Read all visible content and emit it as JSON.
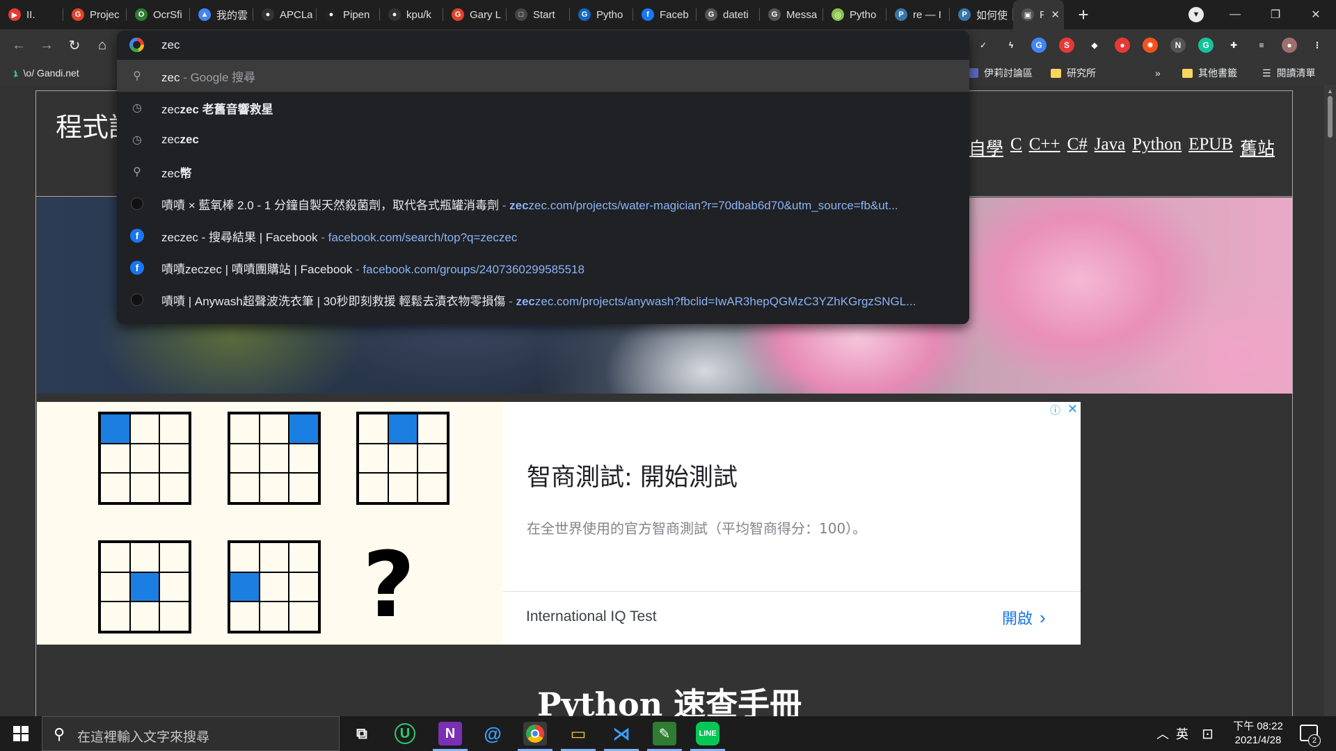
{
  "tabs": [
    {
      "title": "II.",
      "color": "#e53935",
      "glyph": "▶"
    },
    {
      "title": "Projec",
      "color": "#e24329",
      "glyph": "G"
    },
    {
      "title": "OcrSfi",
      "color": "#2e7d32",
      "glyph": "O"
    },
    {
      "title": "我的雲",
      "color": "#4285f4",
      "glyph": "▲"
    },
    {
      "title": "APCLa",
      "color": "#333333",
      "glyph": "●"
    },
    {
      "title": "Pipen",
      "color": "#222222",
      "glyph": "●"
    },
    {
      "title": "kpu/k",
      "color": "#333333",
      "glyph": "●"
    },
    {
      "title": "Gary L",
      "color": "#e24329",
      "glyph": "G"
    },
    {
      "title": "Start",
      "color": "#444444",
      "glyph": "□"
    },
    {
      "title": "Pytho",
      "color": "#1565c0",
      "glyph": "G"
    },
    {
      "title": "Faceb",
      "color": "#1877f2",
      "glyph": "f"
    },
    {
      "title": "dateti",
      "color": "#555555",
      "glyph": "G"
    },
    {
      "title": "Messa",
      "color": "#555555",
      "glyph": "G"
    },
    {
      "title": "Pytho",
      "color": "#8bc34a",
      "glyph": "◎"
    },
    {
      "title": "re — I",
      "color": "#3776ab",
      "glyph": "P"
    },
    {
      "title": "如何使",
      "color": "#3776ab",
      "glyph": "P"
    }
  ],
  "active_tab": {
    "title": "Py",
    "close": "✕"
  },
  "new_tab": "+",
  "window_controls": {
    "minimize": "—",
    "maximize": "❐",
    "close": "✕"
  },
  "toolbar": {
    "back": "←",
    "forward": "→",
    "reload": "↻",
    "home": "⌂"
  },
  "extensions": [
    {
      "name": "check-icon",
      "glyph": "✓",
      "color": "#353535"
    },
    {
      "name": "bolt-icon",
      "glyph": "ϟ",
      "color": "#353535"
    },
    {
      "name": "translate-icon",
      "glyph": "G",
      "color": "#4285f4"
    },
    {
      "name": "s-extension-icon",
      "glyph": "S",
      "color": "#e53935"
    },
    {
      "name": "diamond-icon",
      "glyph": "◆",
      "color": "#353535"
    },
    {
      "name": "record-icon",
      "glyph": "●",
      "color": "#e53935"
    },
    {
      "name": "fire-icon",
      "glyph": "✹",
      "color": "#f4511e"
    },
    {
      "name": "notion-icon",
      "glyph": "N",
      "color": "#555555"
    },
    {
      "name": "grammarly-icon",
      "glyph": "G",
      "color": "#15c39a"
    },
    {
      "name": "puzzle-icon",
      "glyph": "✚",
      "color": "#353535"
    },
    {
      "name": "reading-list-icon",
      "glyph": "≡",
      "color": "#353535"
    },
    {
      "name": "profile-avatar",
      "glyph": "●",
      "color": "#9e6f6f"
    },
    {
      "name": "menu-icon",
      "glyph": "⋮",
      "color": "#353535"
    }
  ],
  "bookmarks": {
    "gandi": "\\o/ Gandi.net",
    "forum": "伊莉討論區",
    "institute": "研究所",
    "more": "»",
    "other": "其他書籤",
    "reading_list": "閱讀清單"
  },
  "omnibox": {
    "query": "zec",
    "rows": [
      {
        "kind": "search",
        "match": "zec",
        "rest": "",
        "sep": " - ",
        "url_match": "",
        "url_rest": "Google 搜尋",
        "url_plain": true
      },
      {
        "kind": "history",
        "match": "zec",
        "rest": "zec 老舊音響救星",
        "sep": "",
        "url_match": "",
        "url_rest": ""
      },
      {
        "kind": "history",
        "match": "zec",
        "rest": "zec",
        "sep": "",
        "url_match": "",
        "url_rest": ""
      },
      {
        "kind": "search",
        "match": "zec",
        "rest": "幣",
        "sep": "",
        "url_match": "",
        "url_rest": ""
      },
      {
        "kind": "zec",
        "match": "",
        "rest": "嘖嘖 × 藍氧棒 2.0 - 1 分鐘自製天然殺菌劑，取代各式瓶罐消毒劑",
        "sep": " - ",
        "url_match": "zec",
        "url_rest": "zec.com/projects/water-magician?r=70dbab6d70&utm_source=fb&ut..."
      },
      {
        "kind": "facebook",
        "match": "",
        "rest": "zeczec - 搜尋結果 | Facebook",
        "sep": " - ",
        "url_match": "",
        "url_rest": "facebook.com/search/top?q=zeczec"
      },
      {
        "kind": "facebook",
        "match": "",
        "rest": "嘖嘖zeczec | 嘖嘖團購站 | Facebook",
        "sep": " - ",
        "url_match": "",
        "url_rest": "facebook.com/groups/2407360299585518"
      },
      {
        "kind": "zec",
        "match": "",
        "rest": "嘖嘖 | Anywash超聲波洗衣筆 | 30秒即刻救援 輕鬆去漬衣物零損傷",
        "sep": " - ",
        "url_match": "zec",
        "url_rest": "zec.com/projects/anywash?fbclid=IwAR3hepQGMzC3YZhKGrgzSNGL..."
      }
    ]
  },
  "site": {
    "title": "程式設計",
    "nav": [
      "何自學",
      "C",
      "C++",
      "C#",
      "Java",
      "Python",
      "EPUB",
      "舊站"
    ]
  },
  "ad": {
    "title": "智商測試: 開始測試",
    "description": "在全世界使用的官方智商測試（平均智商得分：100）。",
    "brand": "International IQ Test",
    "open": "開啟",
    "question_mark": "?",
    "puzzle_fills": [
      0,
      2,
      1,
      4,
      3
    ]
  },
  "page_heading": "Python 速查手冊",
  "taskbar": {
    "search_placeholder": "在這裡輸入文字來搜尋",
    "ime": "英",
    "time": "下午 08:22",
    "date": "2021/4/28",
    "notification_count": "2"
  }
}
